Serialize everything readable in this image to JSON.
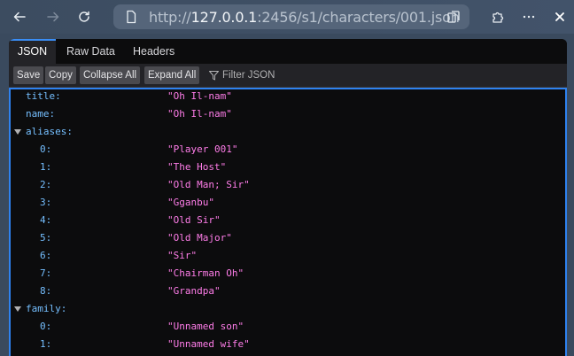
{
  "browser": {
    "url_prefix": "http://",
    "url_host": "127.0.0.1",
    "url_rest": ":2456/s1/characters/001.json"
  },
  "viewer": {
    "tabs": [
      {
        "label": "JSON",
        "active": true
      },
      {
        "label": "Raw Data",
        "active": false
      },
      {
        "label": "Headers",
        "active": false
      }
    ],
    "buttons": {
      "save": "Save",
      "copy": "Copy",
      "collapse_all": "Collapse All",
      "expand_all": "Expand All"
    },
    "filter_placeholder": "Filter JSON"
  },
  "json": {
    "title": {
      "key": "title:",
      "value": "\"Oh Il-nam\""
    },
    "name": {
      "key": "name:",
      "value": "\"Oh Il-nam\""
    },
    "aliases_key": "aliases:",
    "aliases": [
      {
        "key": "0:",
        "value": "\"Player 001\""
      },
      {
        "key": "1:",
        "value": "\"The Host\""
      },
      {
        "key": "2:",
        "value": "\"Old Man; Sir\""
      },
      {
        "key": "3:",
        "value": "\"Gganbu\""
      },
      {
        "key": "4:",
        "value": "\"Old Sir\""
      },
      {
        "key": "5:",
        "value": "\"Old Major\""
      },
      {
        "key": "6:",
        "value": "\"Sir\""
      },
      {
        "key": "7:",
        "value": "\"Chairman Oh\""
      },
      {
        "key": "8:",
        "value": "\"Grandpa\""
      }
    ],
    "family_key": "family:",
    "family": [
      {
        "key": "0:",
        "value": "\"Unnamed son\""
      },
      {
        "key": "1:",
        "value": "\"Unnamed wife\""
      }
    ]
  }
}
